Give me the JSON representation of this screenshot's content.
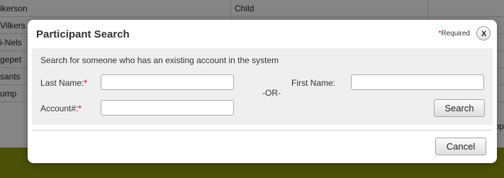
{
  "background": {
    "rows": [
      {
        "c1": "ikerson",
        "c2": "Child",
        "c3": ""
      },
      {
        "c1": "Vilkers",
        "c2": "",
        "c3": ""
      },
      {
        "c1": "i-Nels",
        "c2": "",
        "c3": ""
      },
      {
        "c1": "gepet",
        "c2": "",
        "c3": ""
      },
      {
        "c1": "sants",
        "c2": "",
        "c3": ""
      },
      {
        "c1": "ump",
        "c2": "",
        "c3": ""
      },
      {
        "c1": "",
        "c2": "",
        "c3": "op"
      }
    ],
    "footer_color": "#8f9a0e"
  },
  "modal": {
    "title": "Participant Search",
    "required_star": "*",
    "required_text": "Required",
    "close_label": "X",
    "intro": "Search for someone who has an existing account in the system",
    "last_name_label": "Last Name:",
    "last_name_value": "",
    "account_label": "Account#:",
    "account_value": "",
    "or_text": "-OR-",
    "first_name_label": "First Name:",
    "first_name_value": "",
    "search_button": "Search",
    "cancel_button": "Cancel",
    "required_marker": "*"
  },
  "colors": {
    "required": "#cc0000",
    "panel": "#efefef"
  }
}
